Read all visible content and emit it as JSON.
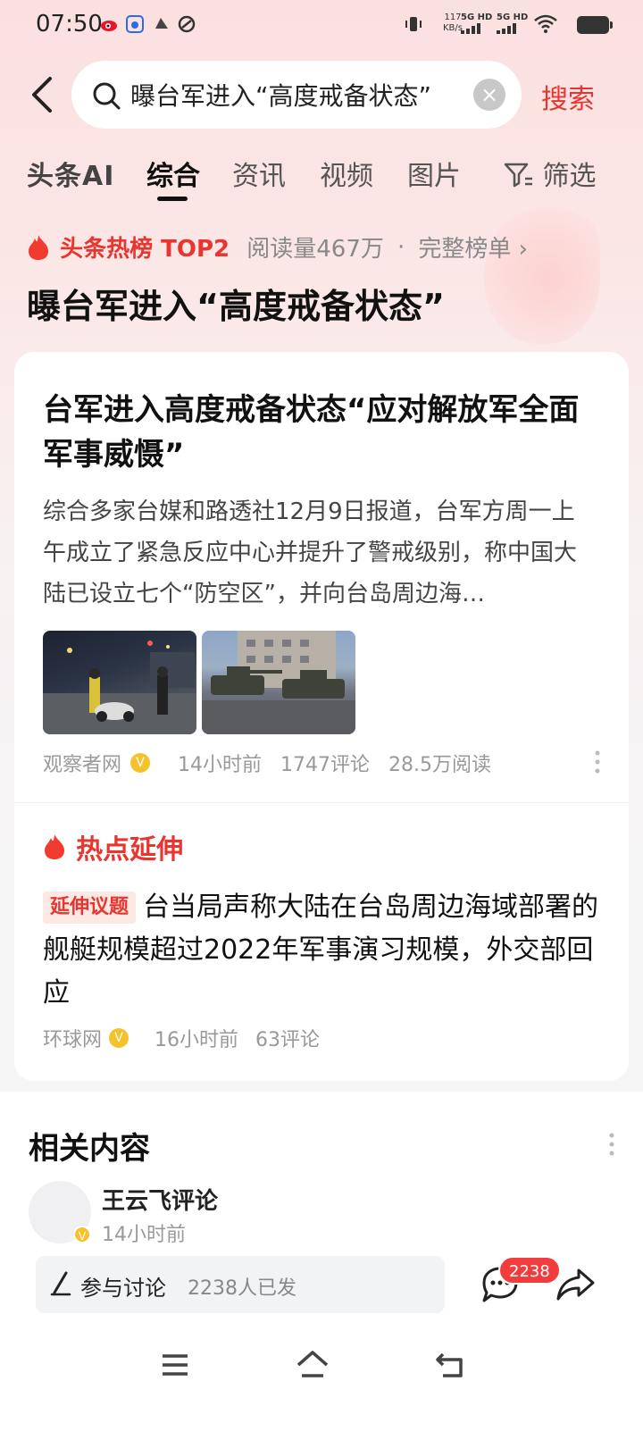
{
  "status_bar": {
    "time": "07:50",
    "net_speed_value": "117",
    "net_speed_unit": "KB/s",
    "sim1": "5G HD",
    "sim2": "5G HD"
  },
  "search": {
    "query": "曝台军进入“高度戒备状态”",
    "submit_label": "搜索"
  },
  "tabs": [
    {
      "label": "头条AI"
    },
    {
      "label": "综合",
      "active": true
    },
    {
      "label": "资讯"
    },
    {
      "label": "视频"
    },
    {
      "label": "图片"
    },
    {
      "label": "筛选"
    }
  ],
  "hot_rank": {
    "label": "头条热榜 TOP2",
    "reads": "阅读量467万",
    "separator": "·",
    "link": "完整榜单 ›",
    "topic": "曝台军进入“高度戒备状态”"
  },
  "article": {
    "title": "台军进入高度戒备状态“应对解放军全面军事威慑”",
    "summary": "综合多家台媒和路透社12月9日报道，台军方周一上午成立了紧急反应中心并提升了警戒级别，称中国大陆已设立七个“防空区”，并向台岛周边海…",
    "source": "观察者网",
    "time": "14小时前",
    "comments": "1747评论",
    "reads": "28.5万阅读"
  },
  "extension": {
    "heading": "热点延伸",
    "tag": "延伸议题",
    "text": "台当局声称大陆在台岛周边海域部署的舰艇规模超过2022年军事演习规模，外交部回应",
    "source": "环球网",
    "time": "16小时前",
    "comments": "63评论"
  },
  "related": {
    "title": "相关内容",
    "author": "王云飞评论",
    "time": "14小时前"
  },
  "action_bar": {
    "discuss_label": "参与讨论",
    "discuss_count": "2238人已发",
    "comment_badge": "2238"
  },
  "colors": {
    "accent": "#e8352f",
    "badge": "#f5c22e"
  }
}
